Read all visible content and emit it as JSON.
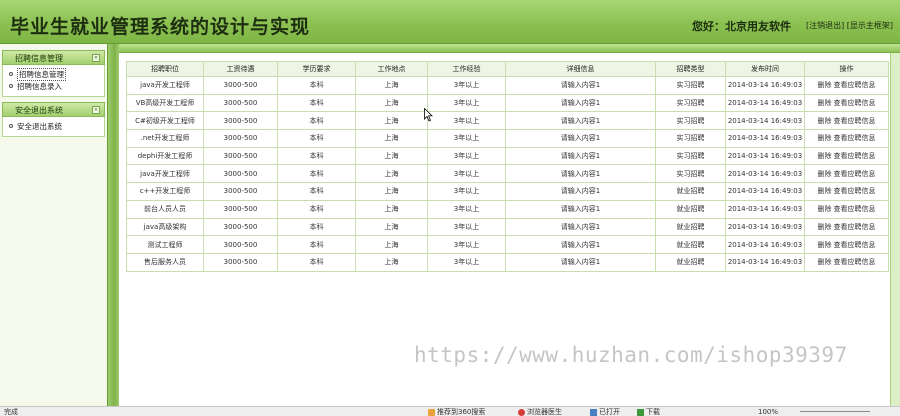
{
  "header": {
    "title": "毕业生就业管理系统的设计与实现",
    "welcome": "您好：北京用友软件",
    "links": [
      "[注销退出]",
      "[显示主框架]"
    ]
  },
  "sidebar": {
    "sections": [
      {
        "title": "招聘信息管理",
        "toggle": "«",
        "items": [
          "招聘信息管理",
          "招聘信息录入"
        ]
      },
      {
        "title": "安全退出系统",
        "toggle": "«",
        "items": [
          "安全退出系统"
        ]
      }
    ]
  },
  "table": {
    "headers": [
      "招聘职位",
      "工资待遇",
      "学历要求",
      "工作地点",
      "工作经验",
      "详细信息",
      "招聘类型",
      "发布时间",
      "操作"
    ],
    "rows": [
      [
        "java开发工程师",
        "3000-500",
        "本科",
        "上海",
        "3年以上",
        "请输入内容1",
        "实习招聘",
        "2014-03-14 16:49:03"
      ],
      [
        "VB高级开发工程师",
        "3000-500",
        "本科",
        "上海",
        "3年以上",
        "请输入内容1",
        "实习招聘",
        "2014-03-14 16:49:03"
      ],
      [
        "C#初级开发工程师",
        "3000-500",
        "本科",
        "上海",
        "3年以上",
        "请输入内容1",
        "实习招聘",
        "2014-03-14 16:49:03"
      ],
      [
        ".net开发工程师",
        "3000-500",
        "本科",
        "上海",
        "3年以上",
        "请输入内容1",
        "实习招聘",
        "2014-03-14 16:49:03"
      ],
      [
        "dephi开发工程师",
        "3000-500",
        "本科",
        "上海",
        "3年以上",
        "请输入内容1",
        "实习招聘",
        "2014-03-14 16:49:03"
      ],
      [
        "java开发工程师",
        "3000-500",
        "本科",
        "上海",
        "3年以上",
        "请输入内容1",
        "实习招聘",
        "2014-03-14 16:49:03"
      ],
      [
        "c++开发工程师",
        "3000-500",
        "本科",
        "上海",
        "3年以上",
        "请输入内容1",
        "就业招聘",
        "2014-03-14 16:49:03"
      ],
      [
        "前台人员人员",
        "3000-500",
        "本科",
        "上海",
        "3年以上",
        "请输入内容1",
        "就业招聘",
        "2014-03-14 16:49:03"
      ],
      [
        "java高级架构",
        "3000-500",
        "本科",
        "上海",
        "3年以上",
        "请输入内容1",
        "就业招聘",
        "2014-03-14 16:49:03"
      ],
      [
        "测试工程师",
        "3000-500",
        "本科",
        "上海",
        "3年以上",
        "请输入内容1",
        "就业招聘",
        "2014-03-14 16:49:03"
      ],
      [
        "售后服务人员",
        "3000-500",
        "本科",
        "上海",
        "3年以上",
        "请输入内容1",
        "就业招聘",
        "2014-03-14 16:49:03"
      ]
    ],
    "row_actions": [
      "删除",
      "查看应聘信息"
    ]
  },
  "watermark": "https://www.huzhan.com/ishop39397",
  "statusbar": {
    "left": "完成",
    "items": [
      "推荐到360搜索",
      "浏览器医生",
      "已打开",
      "下载"
    ],
    "zoom": "100%"
  },
  "colors": {
    "header_green": "#8cc152",
    "border_green": "#c9ddb0",
    "sidebar_head": "#a3d06e"
  }
}
